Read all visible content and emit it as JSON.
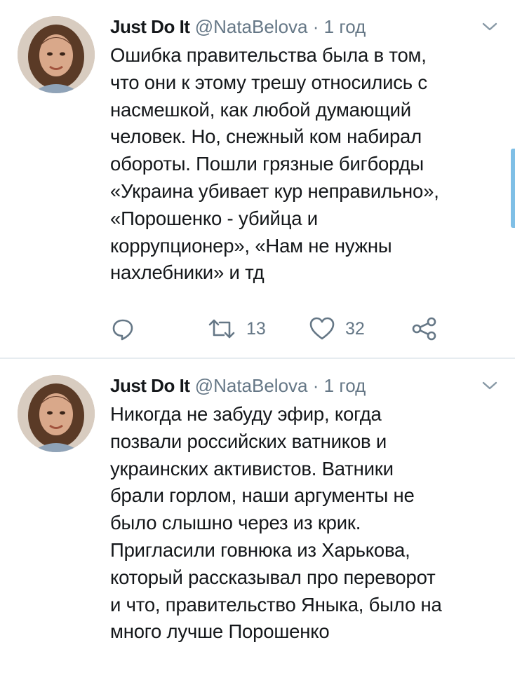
{
  "tweets": [
    {
      "author_name": "Just Do It",
      "handle": "@NataBelova",
      "separator": "·",
      "time": "1 год",
      "text": "Ошибка правительства была в том,\nчто они к этому трешу относились с\nнасмешкой, как любой думающий\nчеловек. Но, снежный ком набирал\nобороты. Пошли грязные бигборды\n«Украина убивает кур неправильно»,\n«Порошенко - убийца и\nкоррупционер», «Нам не нужны\nнахлебники» и тд",
      "retweet_count": "13",
      "like_count": "32"
    },
    {
      "author_name": "Just Do It",
      "handle": "@NataBelova",
      "separator": "·",
      "time": "1 год",
      "text": "Никогда не забуду эфир, когда\nпозвали российских ватников и\nукраинских активистов. Ватники\nбрали горлом, наши аргументы не\nбыло слышно через из крик.\nПригласили говнюка из Харькова,\nкоторый рассказывал про переворот\nи что, правительство Яныка, было на\nмного лучше Порошенко"
    }
  ],
  "icons": {
    "reply": "reply-icon",
    "retweet": "retweet-icon",
    "like": "heart-icon",
    "share": "share-icon",
    "menu": "chevron-down-icon"
  },
  "colors": {
    "text_primary": "#14171a",
    "text_secondary": "#657786",
    "divider": "#e6ecf0",
    "scroll_indicator": "#7fbfe6"
  }
}
